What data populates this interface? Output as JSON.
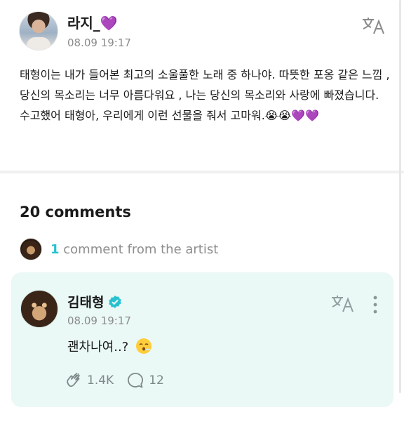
{
  "post": {
    "author_name": "라지_",
    "author_heart": "💜",
    "timestamp": "08.09 19:17",
    "body": "태형이는 내가 들어본 최고의 소울풀한 노래 중 하나야. 따뜻한 포옹 같은 느낌 , 당신의 목소리는 너무 아름다워요 , 나는 당신의 목소리와 사랑에 빠졌습니다. 수고했어 태형아, 우리에게 이런 선물을 줘서 고마워.😭😭💜💜"
  },
  "comments": {
    "title": "20 comments",
    "artist_count": "1",
    "artist_text": "comment from the artist"
  },
  "artist_comment": {
    "author_name": "김태형",
    "timestamp": "08.09 19:17",
    "text": "괜차나여..?",
    "emoji": "😮‍💨",
    "likes": "1.4K",
    "replies": "12"
  },
  "icons": {
    "translate": "translate-icon",
    "verified": "verified-icon",
    "more": "more-vertical-icon",
    "like": "clap-icon",
    "reply": "comment-bubble-icon"
  },
  "colors": {
    "accent": "#27c2cf",
    "card_bg": "#eaf8f6",
    "heart": "#8a3ff0"
  }
}
